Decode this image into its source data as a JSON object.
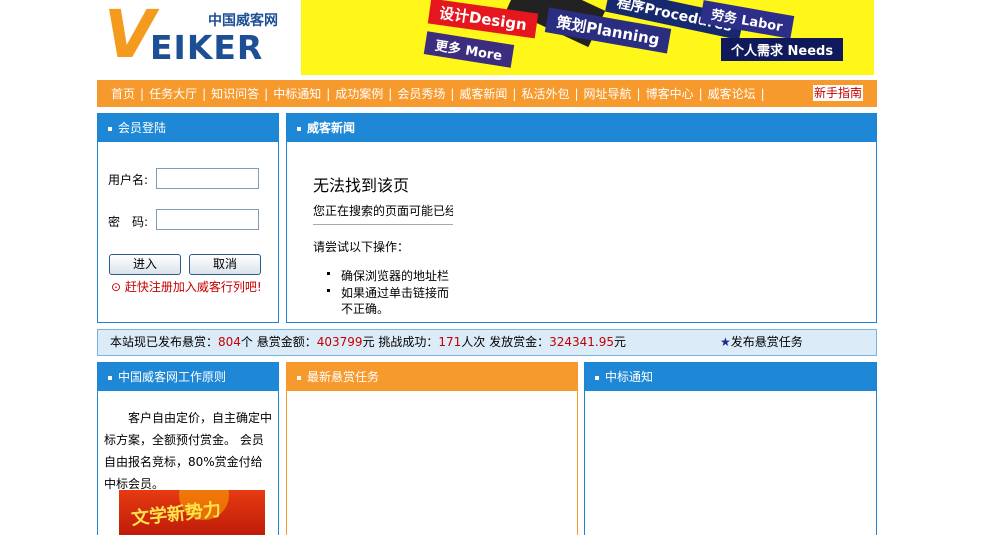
{
  "header": {
    "logo_letter": "V",
    "logo_text": "EIKER",
    "logo_cn": "中国威客网",
    "banner": {
      "design": "设计Design",
      "more": "更多 More",
      "planning": "策划Planning",
      "procedures": "程序Procedures",
      "labor": "劳务 Labor",
      "needs": "个人需求 Needs"
    }
  },
  "nav": {
    "items": [
      "首页",
      "任务大厅",
      "知识问答",
      "中标通知",
      "成功案例",
      "会员秀场",
      "威客新闻",
      "私活外包",
      "网址导航",
      "博客中心",
      "威客论坛"
    ],
    "separator": "|",
    "guide": "新手指南"
  },
  "login": {
    "title": "会员登陆",
    "username_label": "用户名:",
    "password_label": "密　码:",
    "username_value": "",
    "password_value": "",
    "submit": "进入",
    "cancel": "取消",
    "register": "⊙ 赶快注册加入威客行列吧!"
  },
  "news": {
    "title": "威客新闻",
    "error_title": "无法找到该页",
    "error_desc": "您正在搜索的页面可能已经",
    "try_title": "请尝试以下操作：",
    "try_items": [
      "确保浏览器的地址栏",
      "如果通过单击链接而",
      "不正确。"
    ]
  },
  "stats": {
    "p1": "本站现已发布悬赏：",
    "tasks": "804",
    "p2": "个  悬赏金额：",
    "amount": "403799",
    "p3": "元  挑战成功：",
    "success": "171",
    "p4": "人次  发放赏金：",
    "paid": "324341.95",
    "p5": "元",
    "publish_star": "★",
    "publish": "发布悬赏任务"
  },
  "principle": {
    "title": "中国威客网工作原则",
    "text": "客户自由定价，自主确定中标方案，全额预付赏金。 会员自由报名竞标，80%赏金付给中标会员。",
    "promo": "文学新势力"
  },
  "reward": {
    "title": "最新悬赏任务"
  },
  "notice": {
    "title": "中标通知"
  }
}
